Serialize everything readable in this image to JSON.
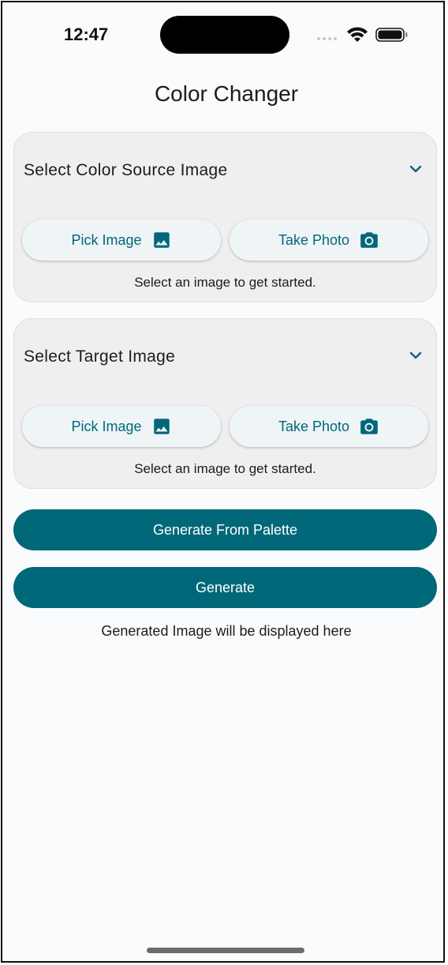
{
  "status_bar": {
    "time": "12:47",
    "icons": [
      "signal-icon",
      "wifi-icon",
      "battery-icon"
    ]
  },
  "app": {
    "title": "Color Changer"
  },
  "colors": {
    "accent": "#006879",
    "card_bg": "#efefef",
    "page_bg": "#f9fbfc"
  },
  "source_card": {
    "title": "Select Color Source Image",
    "pick_label": "Pick Image",
    "photo_label": "Take Photo",
    "hint": "Select an image to get started."
  },
  "target_card": {
    "title": "Select Target Image",
    "pick_label": "Pick Image",
    "photo_label": "Take Photo",
    "hint": "Select an image to get started."
  },
  "actions": {
    "palette_label": "Generate From Palette",
    "generate_label": "Generate"
  },
  "output": {
    "placeholder": "Generated Image will be displayed here"
  }
}
